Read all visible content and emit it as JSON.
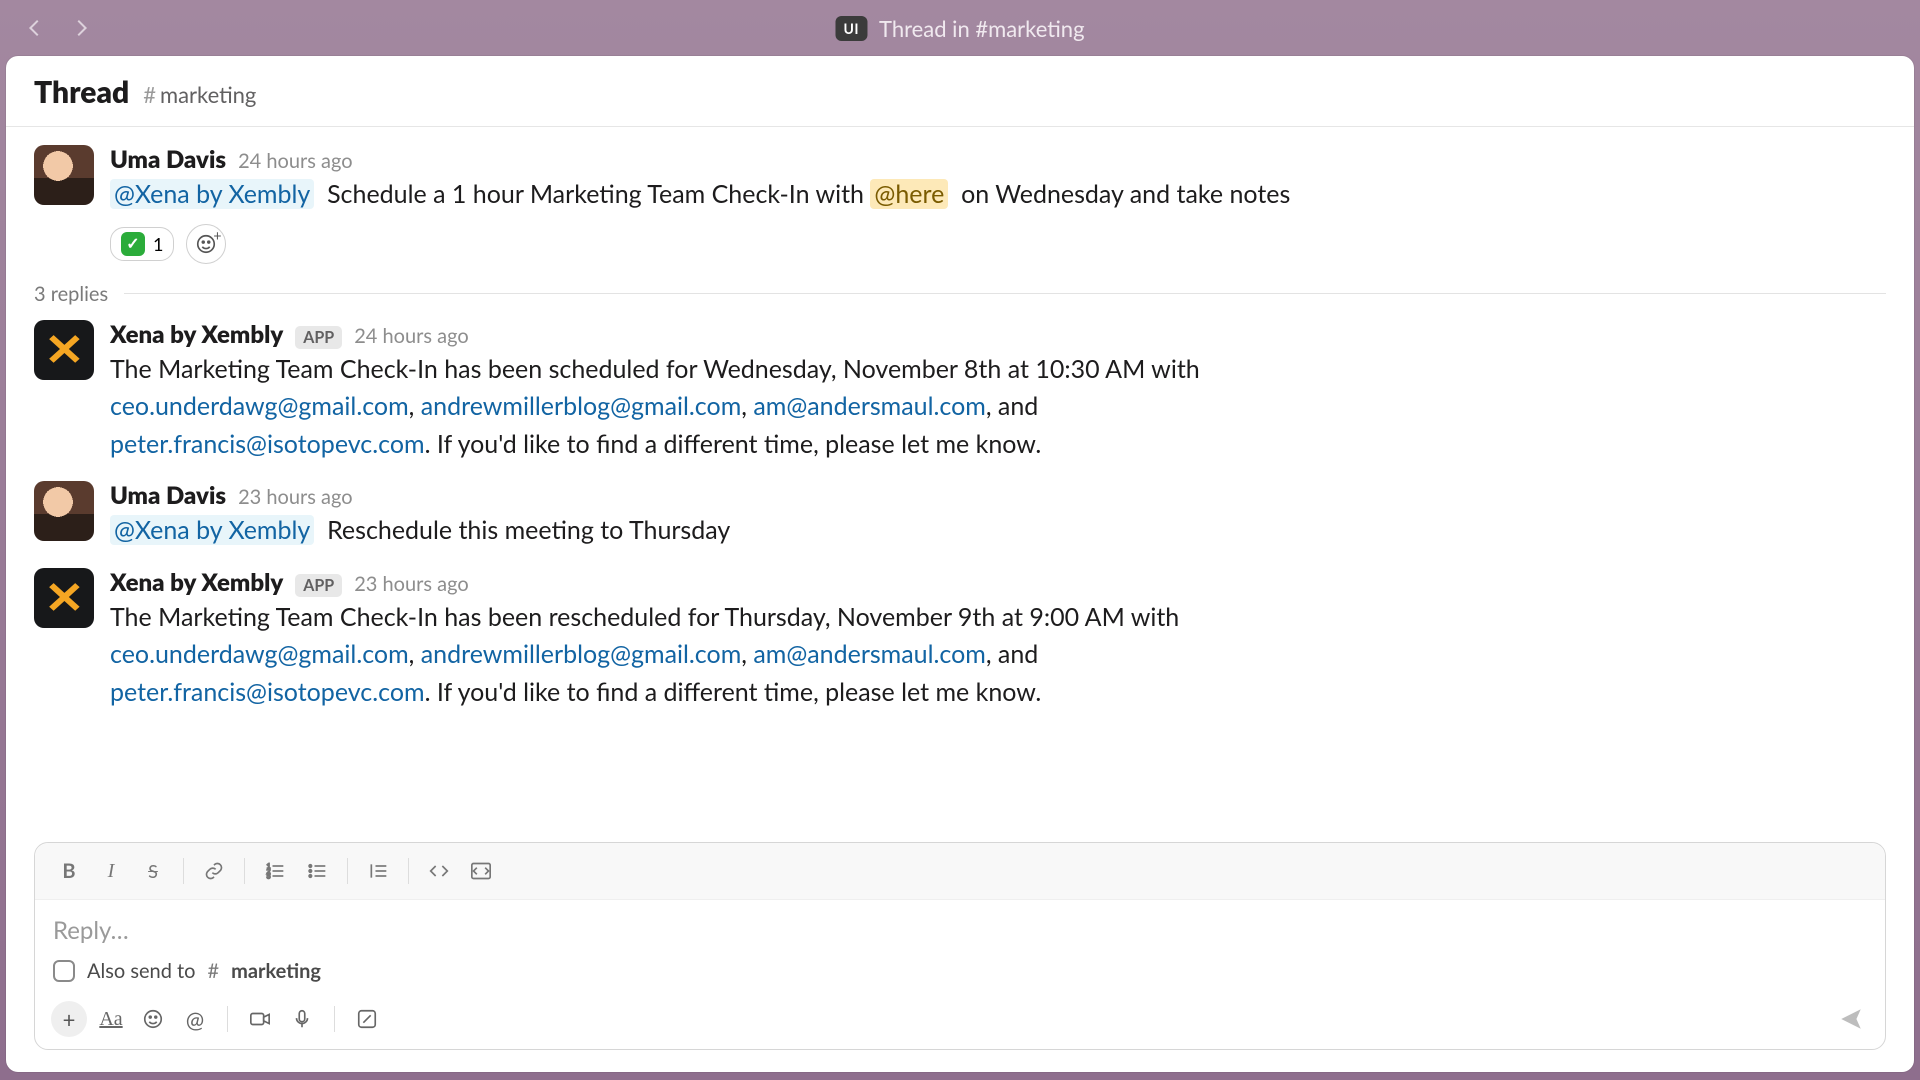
{
  "titlebar": {
    "badge": "UI",
    "title": "Thread in #marketing"
  },
  "header": {
    "title": "Thread",
    "channel": "marketing"
  },
  "root_message": {
    "author": "Uma Davis",
    "timestamp": "24 hours ago",
    "mention": "@Xena by Xembly",
    "text_before_here": "Schedule a 1 hour Marketing Team Check-In with",
    "here": "@here",
    "text_after_here": "on Wednesday and take notes",
    "react_count": "1"
  },
  "reply_count_label": "3 replies",
  "replies": [
    {
      "author": "Xena by Xembly",
      "is_app": true,
      "app_label": "APP",
      "timestamp": "24 hours ago",
      "pre": "The Marketing Team Check-In has been scheduled for Wednesday, November 8th at 10:30 AM with ",
      "links": [
        "ceo.underdawg@gmail.com",
        "andrewmillerblog@gmail.com",
        "am@andersmaul.com",
        "peter.francis@isotopevc.com"
      ],
      "post": ". If you'd like to find a different time, please let me know."
    },
    {
      "author": "Uma Davis",
      "is_app": false,
      "timestamp": "23 hours ago",
      "mention": "@Xena by Xembly",
      "text": "Reschedule this meeting to Thursday"
    },
    {
      "author": "Xena by Xembly",
      "is_app": true,
      "app_label": "APP",
      "timestamp": "23 hours ago",
      "pre": "The Marketing Team Check-In has been rescheduled for Thursday, November 9th at 9:00 AM with ",
      "links": [
        "ceo.underdawg@gmail.com",
        "andrewmillerblog@gmail.com",
        "am@andersmaul.com",
        "peter.francis@isotopevc.com"
      ],
      "post": ". If you'd like to find a different time, please let me know."
    }
  ],
  "composer": {
    "placeholder": "Reply…",
    "also_send_prefix": "Also send to",
    "also_send_channel": "marketing"
  }
}
